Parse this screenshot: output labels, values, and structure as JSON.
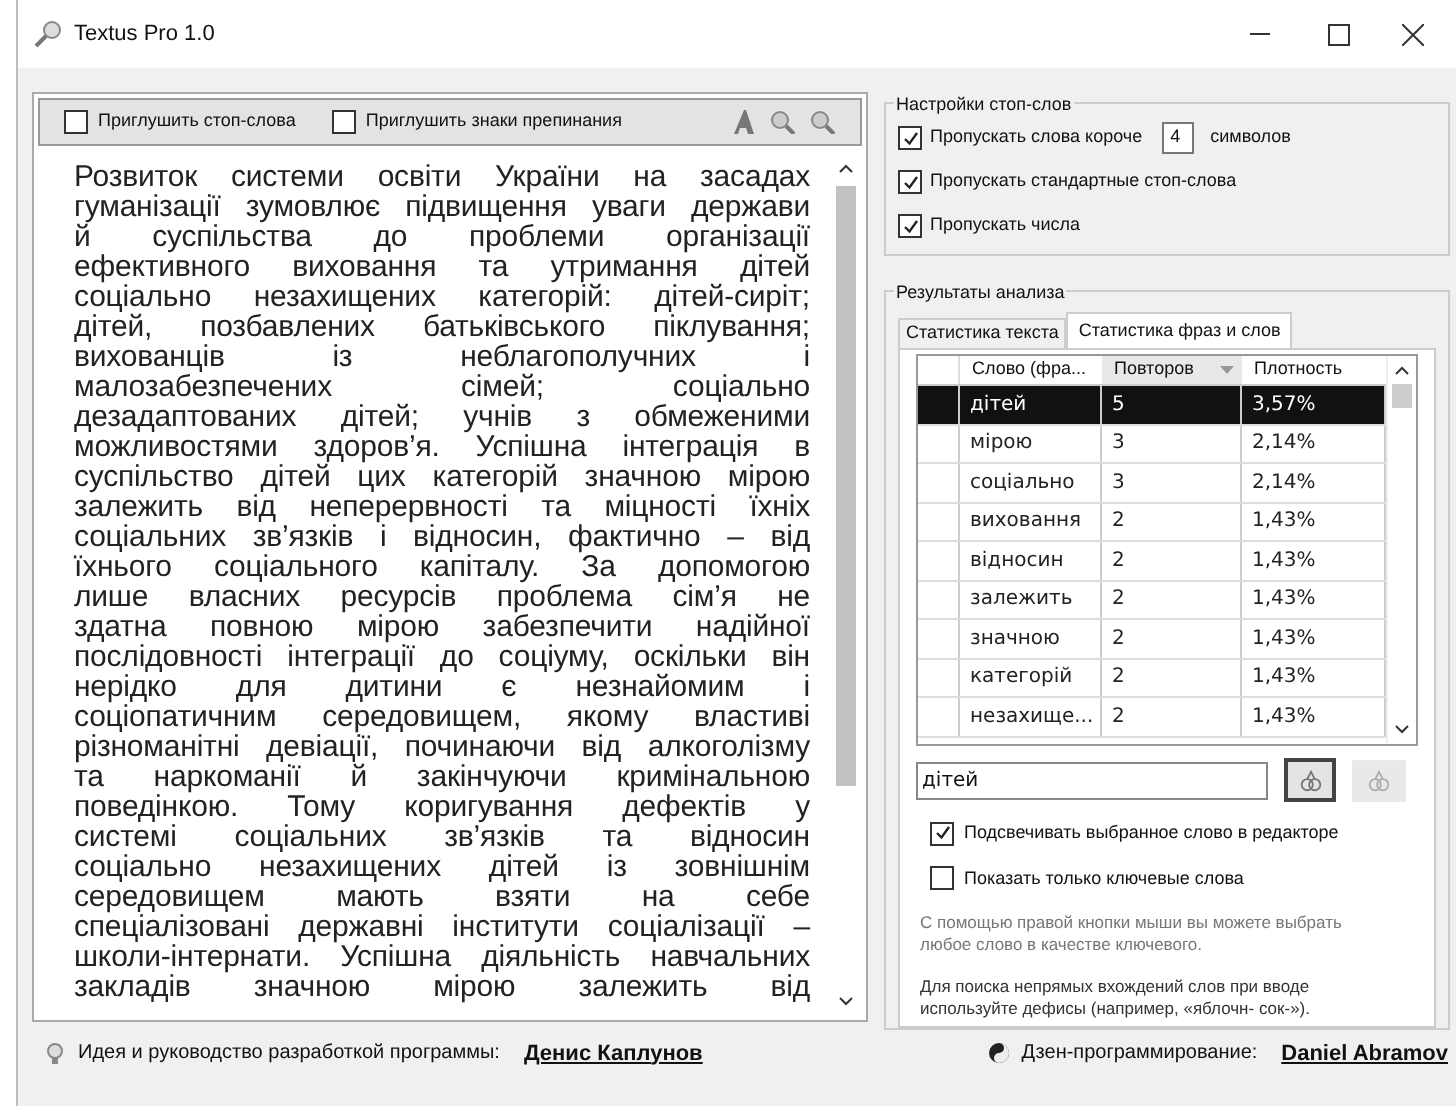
{
  "window": {
    "title": "Textus Pro 1.0"
  },
  "toolbar": {
    "checkboxes": [
      {
        "label": "Приглушить стоп-слова",
        "checked": false
      },
      {
        "label": "Приглушить знаки препинания",
        "checked": false
      }
    ]
  },
  "editor": {
    "lines": [
      "Розвиток системи освіти України на засадах",
      "гуманізації зумовлює підвищення уваги держави",
      "й суспільства до проблеми організації",
      "ефективного виховання та утримання дітей",
      "соціально незахищених категорій: дітей-сиріт;",
      "дітей, позбавлених батьківського піклування;",
      "вихованців із неблагополучних і",
      "малозабезпечених сімей; соціально",
      "дезадаптованих дітей; учнів з обмеженими",
      "можливостями здоров’я. Успішна інтеграція в",
      "суспільство дітей цих категорій значною мірою",
      "залежить від неперервності та міцності їхніх",
      "соціальних зв’язків і відносин, фактично – від",
      "їхнього соціального капіталу. За допомогою",
      "лише власних ресурсів проблема сім’я не",
      "здатна повною мірою забезпечити надійної",
      "послідовності інтеграції до соціуму, оскільки він",
      "нерідко для дитини є незнайомим і",
      "соціопатичним середовищем, якому властиві",
      "різноманітні девіації, починаючи від алкоголізму",
      "та наркоманії й закінчуючи кримінальною",
      "поведінкою. Тому коригування дефектів у",
      "системі соціальних зв’язків та відносин",
      "соціально незахищених дітей із зовнішнім",
      "середовищем мають взяти на себе",
      "спеціалізовані державні інститути соціалізації –",
      "школи-інтернати. Успішна діяльність навчальних",
      "закладів значною мірою залежить від"
    ]
  },
  "stopwords": {
    "title": "Настройки стоп-слов",
    "options": [
      {
        "kind": "number",
        "label": "Пропускать слова короче",
        "checked": true,
        "value": "4",
        "suffix": "символов"
      },
      {
        "kind": "plain",
        "label": "Пропускать стандартные стоп-слова",
        "checked": true
      },
      {
        "kind": "plain",
        "label": "Пропускать числа",
        "checked": true
      }
    ]
  },
  "results": {
    "title": "Результаты анализа",
    "tabs": [
      {
        "label": "Статистика текста",
        "selected": false
      },
      {
        "label": "Статистика фраз и слов",
        "selected": true
      }
    ],
    "table": {
      "columns": [
        {
          "label": "Слово (фра...",
          "sorted": false
        },
        {
          "label": "Повторов",
          "sorted": true
        },
        {
          "label": "Плотность",
          "sorted": false
        }
      ],
      "rows": [
        {
          "word": "дітей",
          "count": "5",
          "density": "3,57%",
          "selected": true
        },
        {
          "word": "мірою",
          "count": "3",
          "density": "2,14%",
          "selected": false
        },
        {
          "word": "соціально",
          "count": "3",
          "density": "2,14%",
          "selected": false
        },
        {
          "word": "виховання",
          "count": "2",
          "density": "1,43%",
          "selected": false
        },
        {
          "word": "відносин",
          "count": "2",
          "density": "1,43%",
          "selected": false
        },
        {
          "word": "залежить",
          "count": "2",
          "density": "1,43%",
          "selected": false
        },
        {
          "word": "значною",
          "count": "2",
          "density": "1,43%",
          "selected": false
        },
        {
          "word": "категорій",
          "count": "2",
          "density": "1,43%",
          "selected": false
        },
        {
          "word": "незахище...",
          "count": "2",
          "density": "1,43%",
          "selected": false
        }
      ]
    },
    "search": {
      "value": "дітей"
    },
    "options": [
      {
        "label": "Подсвечивать выбранное слово в редакторе",
        "checked": true
      },
      {
        "label": "Показать только ключевые слова",
        "checked": false
      }
    ],
    "notes": [
      "С помощью правой кнопки мыши вы можете выбрать любое слово в качестве ключевого.",
      "Для поиска непрямых вхождений слов при вводе используйте дефисы (например, «яблочн- сок-»)."
    ]
  },
  "footer": [
    {
      "label": "Идея и руководство разработкой программы:",
      "link": "Денис Каплунов"
    },
    {
      "label": "Дзен-программирование:",
      "link": "Daniel Abramov"
    }
  ]
}
